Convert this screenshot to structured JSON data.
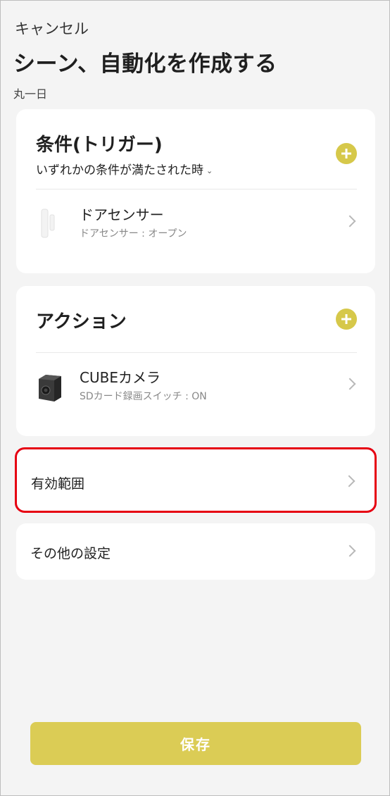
{
  "header": {
    "cancel_label": "キャンセル",
    "title": "シーン、自動化を作成する",
    "schedule": "丸一日"
  },
  "trigger_section": {
    "title": "条件(トリガー)",
    "condition_mode": "いずれかの条件が満たされた時",
    "device": {
      "name": "ドアセンサー",
      "detail": "ドアセンサー : オープン",
      "icon": "door-sensor-icon"
    }
  },
  "action_section": {
    "title": "アクション",
    "device": {
      "name": "CUBEカメラ",
      "detail": "SDカード録画スイッチ : ON",
      "icon": "cube-camera-icon"
    }
  },
  "scope": {
    "label": "有効範囲"
  },
  "other_settings": {
    "label": "その他の設定"
  },
  "save_label": "保存",
  "colors": {
    "accent": "#d6c84a",
    "save_button": "#dbcc55",
    "highlight_border": "#e60012",
    "background": "#f4f4f4",
    "card": "#ffffff"
  }
}
